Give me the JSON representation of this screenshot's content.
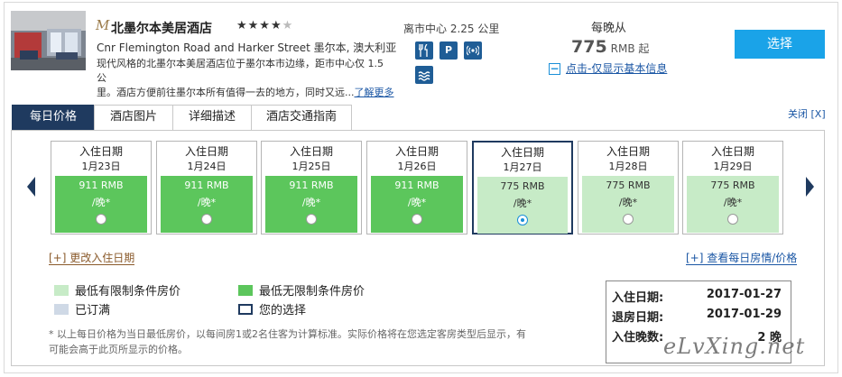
{
  "hotel": {
    "logo_glyph": "M",
    "name": "北墨尔本美居酒店",
    "stars_on": "★★★★",
    "stars_off": "★",
    "address": "Cnr Flemington Road and Harker Street 墨尔本, 澳大利亚",
    "desc_line1": "现代风格的北墨尔本美居酒店位于墨尔本市边缘，距市中心仅 1.5 公",
    "desc_line2": "里。酒店方便前往墨尔本所有值得一去的地方，同时又远...",
    "more_link": "了解更多",
    "distance": "离市中心 2.25 公里",
    "amenities": [
      {
        "name": "restaurant",
        "icon": "fork-knife-icon"
      },
      {
        "name": "parking",
        "icon": "parking-icon",
        "label": "P"
      },
      {
        "name": "wifi",
        "icon": "wifi-icon"
      },
      {
        "name": "pool",
        "icon": "pool-icon"
      }
    ]
  },
  "pricing": {
    "per_night_label": "每晚从",
    "price": "775",
    "currency": "RMB 起",
    "basic_info_sign": "−",
    "basic_info_link": "点击-仅显示基本信息",
    "select_button": "选择"
  },
  "tabs": [
    {
      "label": "每日价格",
      "active": true
    },
    {
      "label": "酒店图片",
      "active": false
    },
    {
      "label": "详细描述",
      "active": false
    },
    {
      "label": "酒店交通指南",
      "active": false
    }
  ],
  "close_link": "关闭 [X]",
  "daily": {
    "cards": [
      {
        "label": "入住日期",
        "date": "1月23日",
        "price": "911 RMB",
        "per": "/晚*",
        "type": "unrestricted",
        "selected": false
      },
      {
        "label": "入住日期",
        "date": "1月24日",
        "price": "911 RMB",
        "per": "/晚*",
        "type": "unrestricted",
        "selected": false
      },
      {
        "label": "入住日期",
        "date": "1月25日",
        "price": "911 RMB",
        "per": "/晚*",
        "type": "unrestricted",
        "selected": false
      },
      {
        "label": "入住日期",
        "date": "1月26日",
        "price": "911 RMB",
        "per": "/晚*",
        "type": "unrestricted",
        "selected": false
      },
      {
        "label": "入住日期",
        "date": "1月27日",
        "price": "775 RMB",
        "per": "/晚*",
        "type": "restricted",
        "selected": true
      },
      {
        "label": "入住日期",
        "date": "1月28日",
        "price": "775 RMB",
        "per": "/晚*",
        "type": "restricted",
        "selected": false
      },
      {
        "label": "入住日期",
        "date": "1月29日",
        "price": "775 RMB",
        "per": "/晚*",
        "type": "restricted",
        "selected": false
      }
    ],
    "change_date": "[+] 更改入住日期",
    "view_daily": "[+] 查看每日房情/价格"
  },
  "legend": {
    "restricted": "最低有限制条件房价",
    "unrestricted": "最低无限制条件房价",
    "booked": "已订满",
    "your_choice": "您的选择",
    "colors": {
      "restricted": "#c7ebc7",
      "unrestricted": "#5cc65c",
      "booked": "#cfd9e6",
      "your_choice": "#1f3a5f"
    }
  },
  "note_line1": "* 以上每日价格为当日最低房价，以每间房1或2名住客为计算标准。实际价格将在您选定客房类型后显示，有",
  "note_line2": "可能会高于此页所显示的价格。",
  "summary": {
    "checkin_label": "入住日期:",
    "checkin_value": "2017-01-27",
    "checkout_label": "退房日期:",
    "checkout_value": "2017-01-29",
    "nights_label": "入住晚数:",
    "nights_value": "2 晚"
  },
  "watermark": "eLvXing.net"
}
